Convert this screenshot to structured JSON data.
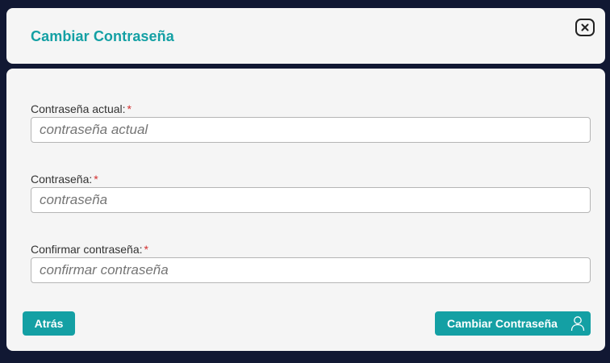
{
  "dialog": {
    "title": "Cambiar Contraseña",
    "close_icon": "close-icon"
  },
  "form": {
    "fields": [
      {
        "label": "Contraseña actual:",
        "required_mark": "*",
        "placeholder": "contraseña actual",
        "value": ""
      },
      {
        "label": "Contraseña:",
        "required_mark": "*",
        "placeholder": "contraseña",
        "value": ""
      },
      {
        "label": "Confirmar contraseña:",
        "required_mark": "*",
        "placeholder": "confirmar contraseña",
        "value": ""
      }
    ]
  },
  "actions": {
    "back_label": "Atrás",
    "submit_label": "Cambiar Contraseña",
    "submit_icon": "user-icon"
  },
  "colors": {
    "accent": "#14a0a4",
    "background": "#111833",
    "card": "#f5f5f5",
    "required": "#d32f2f"
  }
}
